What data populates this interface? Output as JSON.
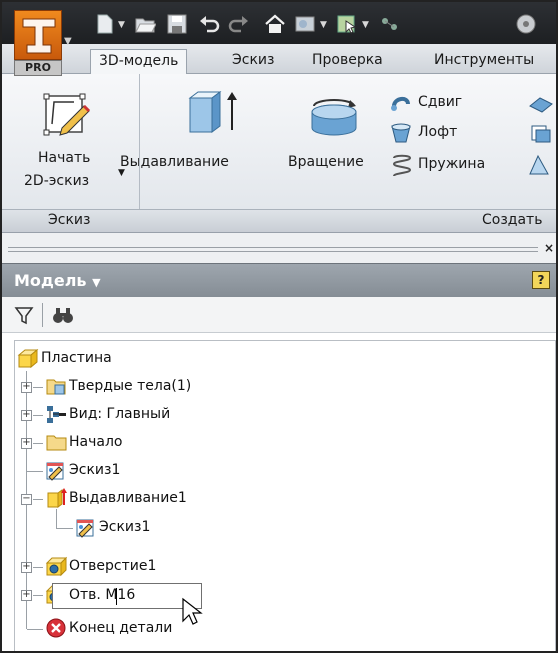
{
  "app": {
    "badge": "PRO"
  },
  "tabs": [
    {
      "label": "3D-модель",
      "active": true
    },
    {
      "label": "Эскиз",
      "active": false
    },
    {
      "label": "Проверка",
      "active": false
    },
    {
      "label": "Инструменты",
      "active": false
    }
  ],
  "ribbon": {
    "start_sketch": {
      "line1": "Начать",
      "line2": "2D-эскиз"
    },
    "extrude": "Выдавливание",
    "revolve": "Вращение",
    "sweep": "Сдвиг",
    "loft": "Лофт",
    "coil": "Пружина",
    "panels": {
      "sketch": "Эскиз",
      "create": "Создать"
    }
  },
  "browser": {
    "title": "Модель",
    "help": "?",
    "tree": {
      "root": "Пластина",
      "solid_bodies": "Твердые тела(1)",
      "view": "Вид: Главный",
      "origin": "Начало",
      "sketch1": "Эскиз1",
      "extrude1": "Выдавливание1",
      "extrude1_sketch": "Эскиз1",
      "hole1": "Отверстие1",
      "rename_value": "Отв. М16",
      "end_of_part": "Конец детали"
    }
  },
  "colors": {
    "titlebar": "#2d3034",
    "brand": "#e8781a",
    "ribbon": "#eef1f4",
    "browser_header": "#8f979f"
  },
  "icons": [
    "new-file-icon",
    "open-icon",
    "save-icon",
    "undo-icon",
    "redo-icon",
    "home-icon",
    "filter-icon",
    "binoculars-icon",
    "help-icon",
    "cursor-icon"
  ]
}
